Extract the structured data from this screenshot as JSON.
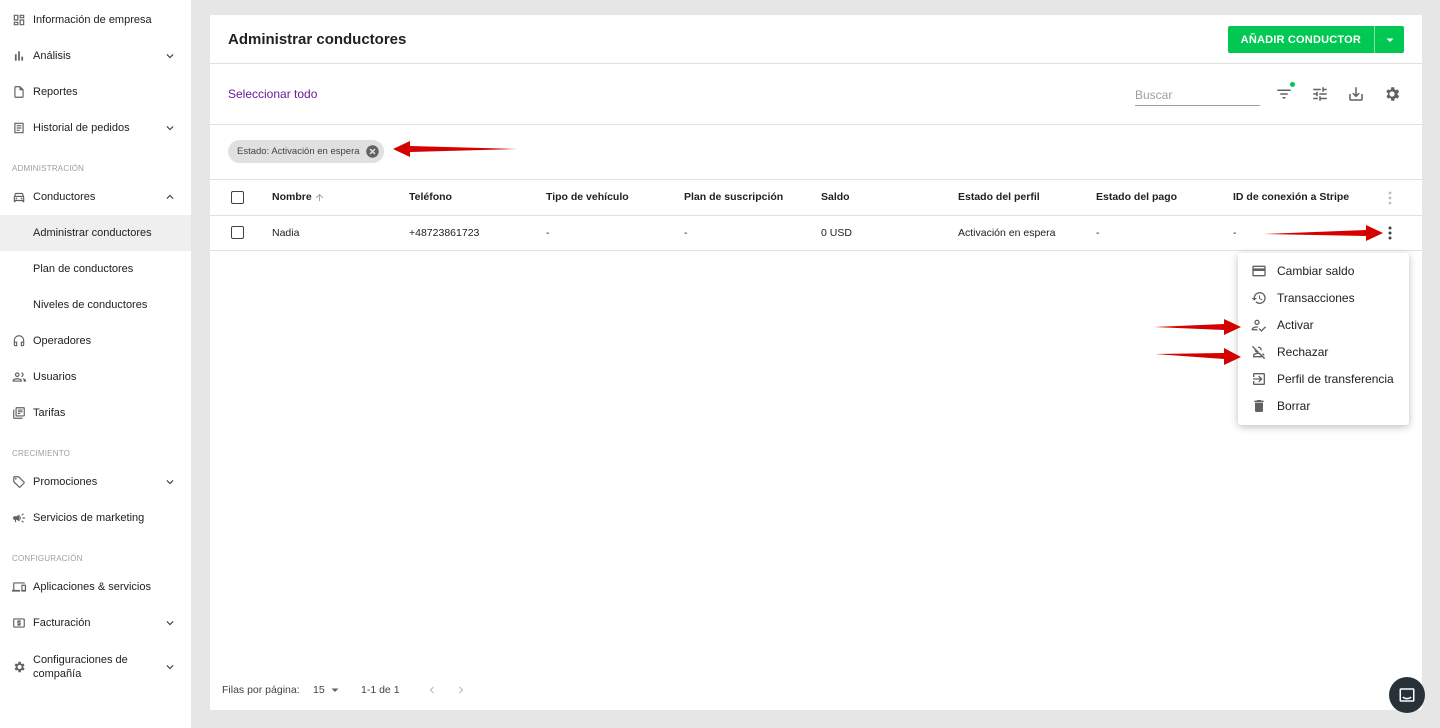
{
  "sidebar": {
    "items": [
      {
        "label": "Información de empresa",
        "icon": "dashboard-icon"
      },
      {
        "label": "Análisis",
        "icon": "bar-chart-icon"
      },
      {
        "label": "Reportes",
        "icon": "report-icon"
      },
      {
        "label": "Historial de pedidos",
        "icon": "list-icon"
      }
    ],
    "section_admin": "ADMINISTRACIÓN",
    "drivers": {
      "label": "Conductores",
      "icon": "car-icon"
    },
    "drivers_sub": [
      "Administrar conductores",
      "Plan de conductores",
      "Niveles de conductores"
    ],
    "admin_items": [
      {
        "label": "Operadores",
        "icon": "headset-icon"
      },
      {
        "label": "Usuarios",
        "icon": "users-icon"
      },
      {
        "label": "Tarifas",
        "icon": "tariffs-icon"
      }
    ],
    "section_growth": "CRECIMIENTO",
    "growth_items": [
      {
        "label": "Promociones",
        "icon": "tag-icon"
      },
      {
        "label": "Servicios de marketing",
        "icon": "megaphone-icon"
      }
    ],
    "section_config": "CONFIGURACIÓN",
    "config_items": [
      {
        "label": "Aplicaciones & servicios",
        "icon": "devices-icon"
      },
      {
        "label": "Facturación",
        "icon": "billing-icon"
      }
    ],
    "company_settings_line1": "Configuraciones de",
    "company_settings_line2": "compañía"
  },
  "header": {
    "title": "Administrar conductores",
    "add_button": "AÑADIR CONDUCTOR"
  },
  "toolbar": {
    "select_all": "Seleccionar todo",
    "search_placeholder": "Buscar"
  },
  "filter_chip": "Estado: Activación en espera",
  "table": {
    "columns": [
      "Nombre",
      "Teléfono",
      "Tipo de vehículo",
      "Plan de suscripción",
      "Saldo",
      "Estado del perfil",
      "Estado del pago",
      "ID de conexión a Stripe"
    ],
    "rows": [
      [
        "Nadia",
        "+48723861723",
        "-",
        "-",
        "0 USD",
        "Activación en espera",
        "-",
        "-"
      ]
    ]
  },
  "context_menu": [
    {
      "label": "Cambiar saldo",
      "icon": "credit-card-icon"
    },
    {
      "label": "Transacciones",
      "icon": "history-icon"
    },
    {
      "label": "Activar",
      "icon": "person-check-icon"
    },
    {
      "label": "Rechazar",
      "icon": "person-off-icon"
    },
    {
      "label": "Perfil de transferencia",
      "icon": "transfer-icon"
    },
    {
      "label": "Borrar",
      "icon": "trash-icon"
    }
  ],
  "footer": {
    "rows_per_page_label": "Filas por página:",
    "rows_per_page_value": "15",
    "range": "1-1 de 1"
  },
  "colors": {
    "accent": "#00c853",
    "link": "#6a1b9a",
    "annotation_arrow": "#d50000"
  }
}
